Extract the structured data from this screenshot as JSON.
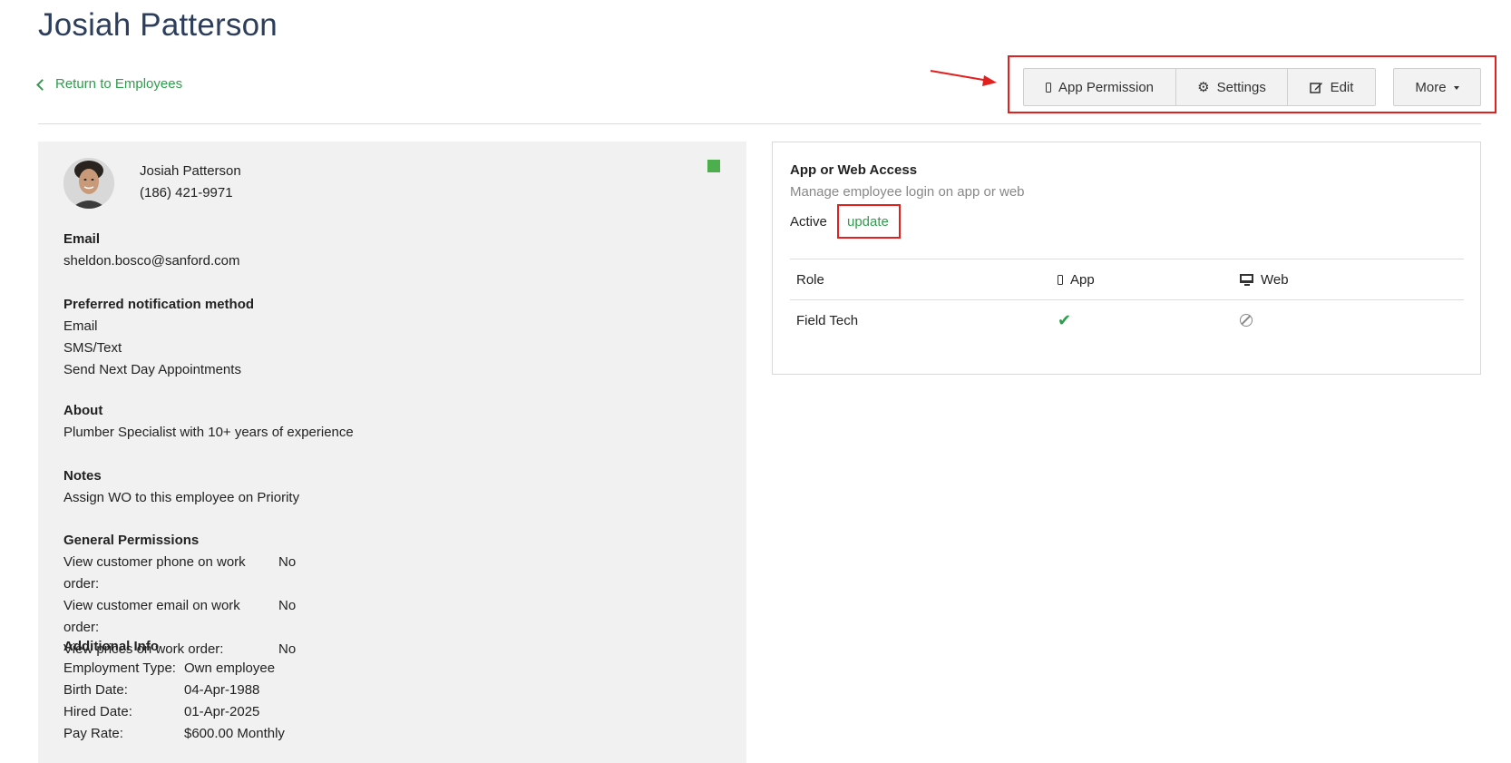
{
  "page": {
    "title": "Josiah Patterson",
    "back_link": "Return to Employees"
  },
  "toolbar": {
    "app_permission": "App Permission",
    "settings": "Settings",
    "edit": "Edit",
    "more": "More"
  },
  "profile": {
    "name": "Josiah Patterson",
    "phone": "(186) 421-9971",
    "status_color": "#4cae4c",
    "email_heading": "Email",
    "email": "sheldon.bosco@sanford.com",
    "notify_heading": "Preferred notification method",
    "notify_items": [
      "Email",
      "SMS/Text",
      "Send Next Day Appointments"
    ],
    "about_heading": "About",
    "about": "Plumber Specialist with 10+ years of experience",
    "notes_heading": "Notes",
    "notes": "Assign WO to this employee on Priority",
    "perm_heading": "General Permissions",
    "permissions": [
      {
        "label": "View customer phone on work order:",
        "value": "No"
      },
      {
        "label": "View customer email on work order:",
        "value": "No"
      },
      {
        "label": "View prices on work order:",
        "value": "No"
      }
    ],
    "additional_heading": "Additional Info",
    "additional": [
      {
        "label": "Employment Type:",
        "value": "Own employee"
      },
      {
        "label": "Birth Date:",
        "value": "04-Apr-1988"
      },
      {
        "label": "Hired Date:",
        "value": "01-Apr-2025"
      },
      {
        "label": "Pay Rate:",
        "value": "$600.00 Monthly"
      }
    ]
  },
  "access": {
    "title": "App or Web Access",
    "subtitle": "Manage employee login on app or web",
    "status": "Active",
    "update_link": "update",
    "columns": {
      "role": "Role",
      "app": "App",
      "web": "Web"
    },
    "row": {
      "role": "Field Tech",
      "app_allowed": true,
      "web_allowed": false
    }
  },
  "annotation_color": "#e32020",
  "accent_color": "#2e9e4c"
}
